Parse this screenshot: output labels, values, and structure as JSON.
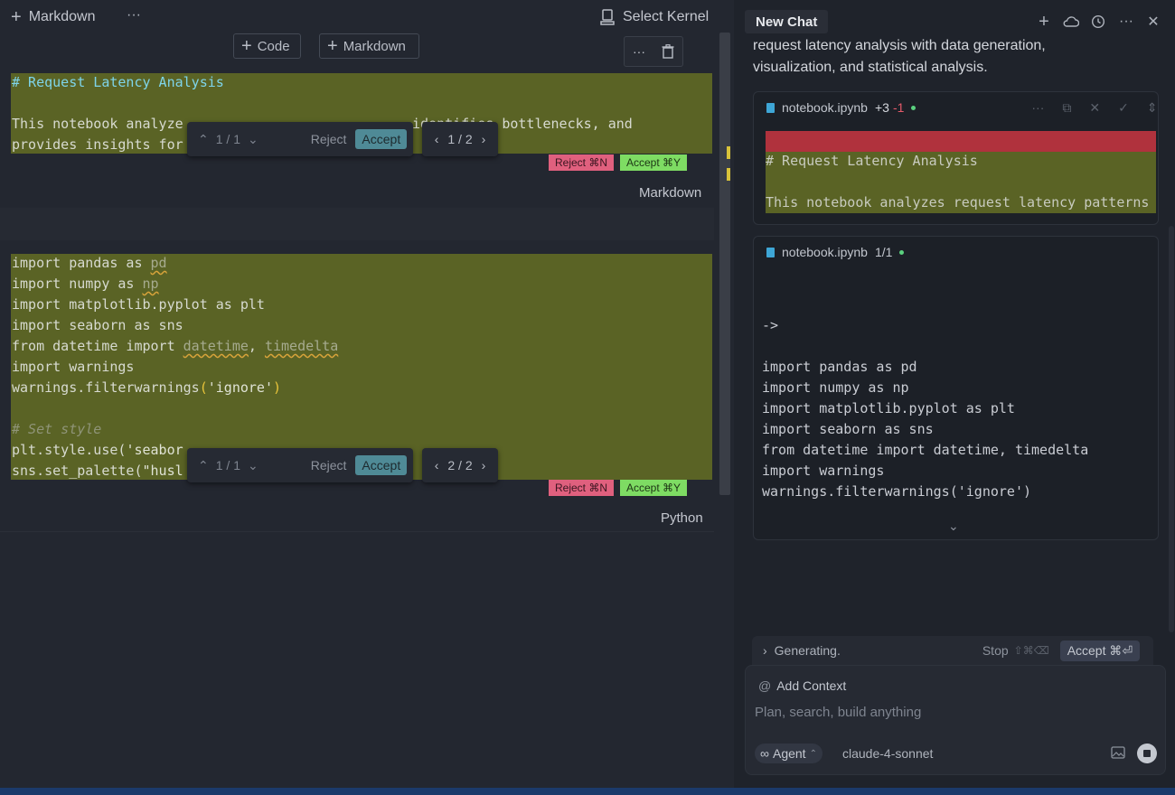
{
  "toolbar": {
    "add_markdown_label": "Markdown",
    "select_kernel_label": "Select Kernel",
    "code_button": "Code",
    "markdown_button": "Markdown"
  },
  "cell1": {
    "heading": "# Request Latency Analysis",
    "line2": "This notebook analyze",
    "line2_tail": "identifies bottlenecks, and",
    "line3": "provides insights for",
    "diff_counter": "1 / 1",
    "reject": "Reject",
    "accept": "Accept",
    "nav_counter": "1 / 2",
    "reject_tag": "Reject ⌘N",
    "accept_tag": "Accept ⌘Y",
    "language": "Markdown"
  },
  "cell2": {
    "diff_counter": "1 / 1",
    "reject": "Reject",
    "accept": "Accept",
    "nav_counter": "2 / 2",
    "reject_tag": "Reject ⌘N",
    "accept_tag": "Accept ⌘Y",
    "language": "Python"
  },
  "chat": {
    "title": "New Chat",
    "intro_line1": "request latency analysis with data generation,",
    "intro_line2": "visualization, and statistical analysis.",
    "card1": {
      "filename": "notebook.ipynb",
      "added": "+3",
      "removed": "-1",
      "line1": "# Request Latency Analysis",
      "line2": "This notebook analyzes request latency patterns"
    },
    "card2": {
      "filename": "notebook.ipynb",
      "count": "1/1",
      "arrow": "->",
      "lines": [
        "import pandas as pd",
        "import numpy as np",
        "import matplotlib.pyplot as plt",
        "import seaborn as sns",
        "from datetime import datetime, timedelta",
        "import warnings",
        "warnings.filterwarnings('ignore')"
      ]
    },
    "status": "Generating.",
    "stop": "Stop",
    "stop_shortcut": "⇧⌘⌫",
    "accept_all": "Accept ⌘⏎",
    "add_context": "Add Context",
    "placeholder": "Plan, search, build anything",
    "mode": "Agent",
    "model": "claude-4-sonnet"
  },
  "colors": {
    "diff_added": "#5a6325",
    "diff_removed": "#b0323d",
    "accept": "#4f8a96"
  }
}
